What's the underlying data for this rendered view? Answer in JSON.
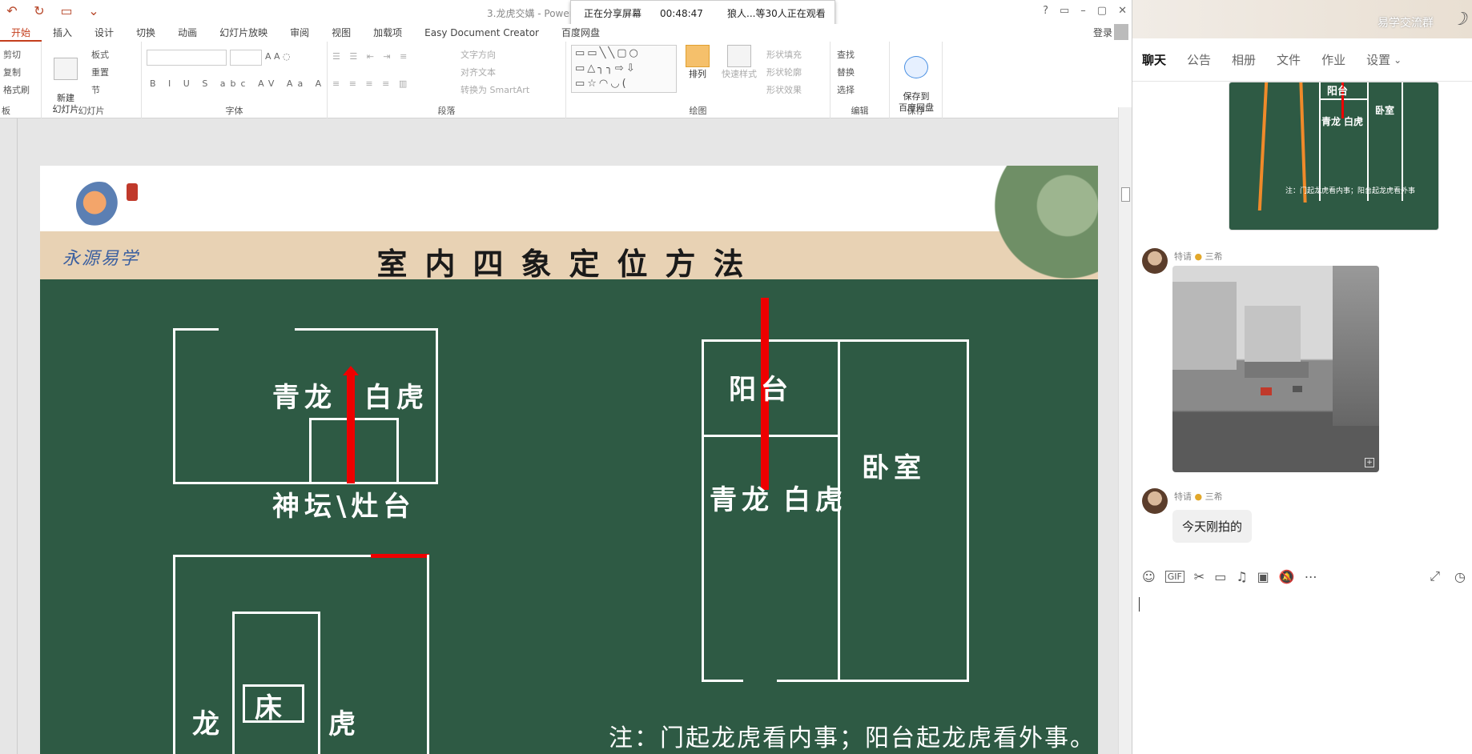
{
  "ppt": {
    "doc_title": "3.龙虎交媾 - PowerPoint",
    "qat_icons": [
      "undo-icon",
      "redo-icon",
      "start-from-beginning-icon",
      "customize-icon"
    ],
    "share": {
      "status": "正在分享屏幕",
      "timer": "00:48:47",
      "viewers": "狼人...等30人正在观看"
    },
    "window_controls": [
      "?",
      "▭",
      "–",
      "▢",
      "✕"
    ],
    "tabs": [
      "开始",
      "插入",
      "设计",
      "切换",
      "动画",
      "幻灯片放映",
      "审阅",
      "视图",
      "加载项",
      "Easy Document Creator",
      "百度网盘"
    ],
    "active_tab": "开始",
    "login": "登录",
    "ribbon": {
      "clipboard": {
        "cut": "剪切",
        "copy": "复制",
        "format_painter": "格式刷",
        "label": "板"
      },
      "slides": {
        "new_slide": "新建\n幻灯片",
        "layout": "板式",
        "reset": "重置",
        "section": "节",
        "label": "幻灯片"
      },
      "font": {
        "label": "字体"
      },
      "paragraph": {
        "text_direction": "文字方向",
        "align_text": "对齐文本",
        "smartart": "转换为 SmartArt",
        "label": "段落"
      },
      "drawing": {
        "arrange": "排列",
        "quick_styles": "快速样式",
        "shape_fill": "形状填充",
        "shape_outline": "形状轮廓",
        "shape_effects": "形状效果",
        "label": "绘图"
      },
      "editing": {
        "find": "查找",
        "replace": "替换",
        "select": "选择",
        "label": "编辑"
      },
      "save": {
        "save_to": "保存到\n百度网盘",
        "label": "保存"
      }
    }
  },
  "slide": {
    "brand": "永源易学",
    "title": "室内四象定位方法",
    "diagram1": {
      "left": "青龙",
      "right": "白虎",
      "caption": "神坛\\灶台"
    },
    "diagram2": {
      "left": "龙",
      "center": "床",
      "right": "虎"
    },
    "diagram3": {
      "balcony": "阳台",
      "left": "青龙",
      "right": "白虎",
      "bedroom": "卧室"
    },
    "note": "注：门起龙虎看内事；阳台起龙虎看外事。"
  },
  "qq": {
    "group_name": "易学交流群",
    "tabs": [
      "聊天",
      "公告",
      "相册",
      "文件",
      "作业",
      "设置"
    ],
    "active_tab": "聊天",
    "preview": {
      "balcony": "阳台",
      "left": "青龙",
      "right": "白虎",
      "bedroom": "卧室",
      "note": "注：门起龙虎看内事；阳台起龙虎看外事"
    },
    "messages": [
      {
        "sender": "特请",
        "badge": "三希",
        "type": "image"
      },
      {
        "sender": "特请",
        "badge": "三希",
        "type": "text",
        "text": "今天刚拍的"
      }
    ],
    "toolbar_icons": [
      "emoji-icon",
      "gif-icon",
      "screenshot-icon",
      "folder-icon",
      "music-icon",
      "image-icon",
      "mute-icon",
      "more-icon",
      "expand-icon",
      "history-icon"
    ],
    "toolbar_glyphs": [
      "☺",
      "GIF",
      "✂",
      "▭",
      "♫",
      "▣",
      "🔕",
      "⋯",
      "⤢",
      "◷"
    ]
  }
}
